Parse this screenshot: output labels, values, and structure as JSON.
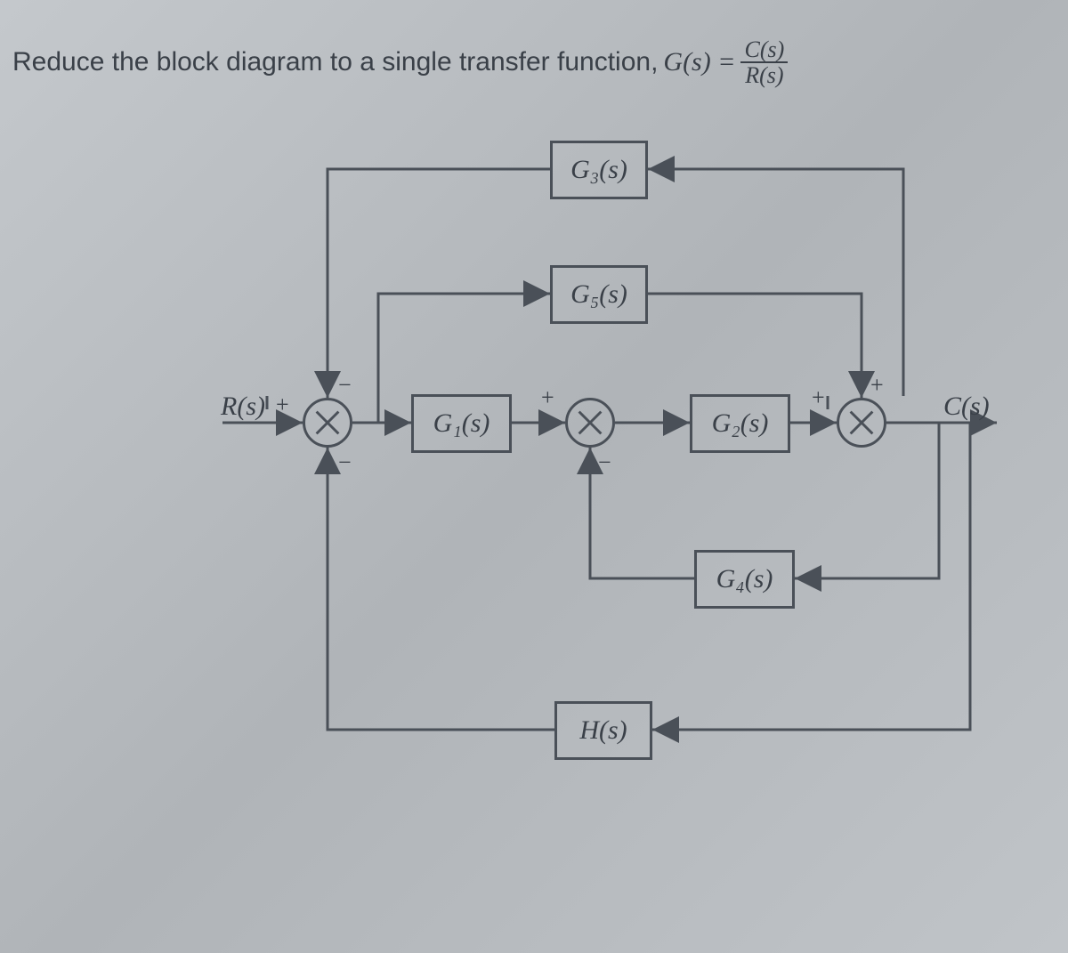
{
  "prompt": {
    "text_before": "Reduce the block diagram to a single transfer function, ",
    "lhs": "G(s) =",
    "frac_num": "C(s)",
    "frac_den": "R(s)"
  },
  "io": {
    "input": "R(s)",
    "output": "C(s)"
  },
  "blocks": {
    "g1": "G₁(s)",
    "g2": "G₂(s)",
    "g3": "G₃(s)",
    "g4": "G₄(s)",
    "g5": "G₅(s)",
    "h": "H(s)"
  },
  "sums": {
    "s1": {
      "top": "−",
      "left": "+",
      "bottom": "−"
    },
    "s2": {
      "top": "+",
      "bottom": "−"
    },
    "s3": {
      "top": "+",
      "left": "+"
    }
  }
}
